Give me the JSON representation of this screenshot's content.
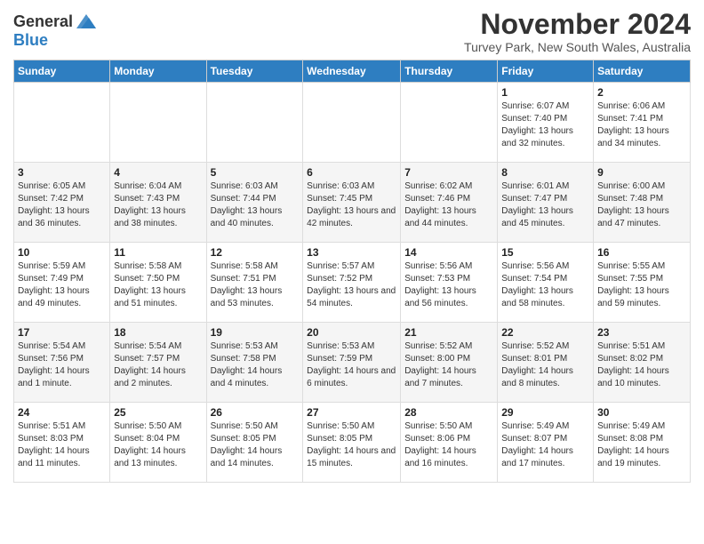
{
  "logo": {
    "general": "General",
    "blue": "Blue"
  },
  "title": "November 2024",
  "subtitle": "Turvey Park, New South Wales, Australia",
  "weekdays": [
    "Sunday",
    "Monday",
    "Tuesday",
    "Wednesday",
    "Thursday",
    "Friday",
    "Saturday"
  ],
  "weeks": [
    [
      {
        "date": "",
        "sunrise": "",
        "sunset": "",
        "daylight": ""
      },
      {
        "date": "",
        "sunrise": "",
        "sunset": "",
        "daylight": ""
      },
      {
        "date": "",
        "sunrise": "",
        "sunset": "",
        "daylight": ""
      },
      {
        "date": "",
        "sunrise": "",
        "sunset": "",
        "daylight": ""
      },
      {
        "date": "",
        "sunrise": "",
        "sunset": "",
        "daylight": ""
      },
      {
        "date": "1",
        "sunrise": "Sunrise: 6:07 AM",
        "sunset": "Sunset: 7:40 PM",
        "daylight": "Daylight: 13 hours and 32 minutes."
      },
      {
        "date": "2",
        "sunrise": "Sunrise: 6:06 AM",
        "sunset": "Sunset: 7:41 PM",
        "daylight": "Daylight: 13 hours and 34 minutes."
      }
    ],
    [
      {
        "date": "3",
        "sunrise": "Sunrise: 6:05 AM",
        "sunset": "Sunset: 7:42 PM",
        "daylight": "Daylight: 13 hours and 36 minutes."
      },
      {
        "date": "4",
        "sunrise": "Sunrise: 6:04 AM",
        "sunset": "Sunset: 7:43 PM",
        "daylight": "Daylight: 13 hours and 38 minutes."
      },
      {
        "date": "5",
        "sunrise": "Sunrise: 6:03 AM",
        "sunset": "Sunset: 7:44 PM",
        "daylight": "Daylight: 13 hours and 40 minutes."
      },
      {
        "date": "6",
        "sunrise": "Sunrise: 6:03 AM",
        "sunset": "Sunset: 7:45 PM",
        "daylight": "Daylight: 13 hours and 42 minutes."
      },
      {
        "date": "7",
        "sunrise": "Sunrise: 6:02 AM",
        "sunset": "Sunset: 7:46 PM",
        "daylight": "Daylight: 13 hours and 44 minutes."
      },
      {
        "date": "8",
        "sunrise": "Sunrise: 6:01 AM",
        "sunset": "Sunset: 7:47 PM",
        "daylight": "Daylight: 13 hours and 45 minutes."
      },
      {
        "date": "9",
        "sunrise": "Sunrise: 6:00 AM",
        "sunset": "Sunset: 7:48 PM",
        "daylight": "Daylight: 13 hours and 47 minutes."
      }
    ],
    [
      {
        "date": "10",
        "sunrise": "Sunrise: 5:59 AM",
        "sunset": "Sunset: 7:49 PM",
        "daylight": "Daylight: 13 hours and 49 minutes."
      },
      {
        "date": "11",
        "sunrise": "Sunrise: 5:58 AM",
        "sunset": "Sunset: 7:50 PM",
        "daylight": "Daylight: 13 hours and 51 minutes."
      },
      {
        "date": "12",
        "sunrise": "Sunrise: 5:58 AM",
        "sunset": "Sunset: 7:51 PM",
        "daylight": "Daylight: 13 hours and 53 minutes."
      },
      {
        "date": "13",
        "sunrise": "Sunrise: 5:57 AM",
        "sunset": "Sunset: 7:52 PM",
        "daylight": "Daylight: 13 hours and 54 minutes."
      },
      {
        "date": "14",
        "sunrise": "Sunrise: 5:56 AM",
        "sunset": "Sunset: 7:53 PM",
        "daylight": "Daylight: 13 hours and 56 minutes."
      },
      {
        "date": "15",
        "sunrise": "Sunrise: 5:56 AM",
        "sunset": "Sunset: 7:54 PM",
        "daylight": "Daylight: 13 hours and 58 minutes."
      },
      {
        "date": "16",
        "sunrise": "Sunrise: 5:55 AM",
        "sunset": "Sunset: 7:55 PM",
        "daylight": "Daylight: 13 hours and 59 minutes."
      }
    ],
    [
      {
        "date": "17",
        "sunrise": "Sunrise: 5:54 AM",
        "sunset": "Sunset: 7:56 PM",
        "daylight": "Daylight: 14 hours and 1 minute."
      },
      {
        "date": "18",
        "sunrise": "Sunrise: 5:54 AM",
        "sunset": "Sunset: 7:57 PM",
        "daylight": "Daylight: 14 hours and 2 minutes."
      },
      {
        "date": "19",
        "sunrise": "Sunrise: 5:53 AM",
        "sunset": "Sunset: 7:58 PM",
        "daylight": "Daylight: 14 hours and 4 minutes."
      },
      {
        "date": "20",
        "sunrise": "Sunrise: 5:53 AM",
        "sunset": "Sunset: 7:59 PM",
        "daylight": "Daylight: 14 hours and 6 minutes."
      },
      {
        "date": "21",
        "sunrise": "Sunrise: 5:52 AM",
        "sunset": "Sunset: 8:00 PM",
        "daylight": "Daylight: 14 hours and 7 minutes."
      },
      {
        "date": "22",
        "sunrise": "Sunrise: 5:52 AM",
        "sunset": "Sunset: 8:01 PM",
        "daylight": "Daylight: 14 hours and 8 minutes."
      },
      {
        "date": "23",
        "sunrise": "Sunrise: 5:51 AM",
        "sunset": "Sunset: 8:02 PM",
        "daylight": "Daylight: 14 hours and 10 minutes."
      }
    ],
    [
      {
        "date": "24",
        "sunrise": "Sunrise: 5:51 AM",
        "sunset": "Sunset: 8:03 PM",
        "daylight": "Daylight: 14 hours and 11 minutes."
      },
      {
        "date": "25",
        "sunrise": "Sunrise: 5:50 AM",
        "sunset": "Sunset: 8:04 PM",
        "daylight": "Daylight: 14 hours and 13 minutes."
      },
      {
        "date": "26",
        "sunrise": "Sunrise: 5:50 AM",
        "sunset": "Sunset: 8:05 PM",
        "daylight": "Daylight: 14 hours and 14 minutes."
      },
      {
        "date": "27",
        "sunrise": "Sunrise: 5:50 AM",
        "sunset": "Sunset: 8:05 PM",
        "daylight": "Daylight: 14 hours and 15 minutes."
      },
      {
        "date": "28",
        "sunrise": "Sunrise: 5:50 AM",
        "sunset": "Sunset: 8:06 PM",
        "daylight": "Daylight: 14 hours and 16 minutes."
      },
      {
        "date": "29",
        "sunrise": "Sunrise: 5:49 AM",
        "sunset": "Sunset: 8:07 PM",
        "daylight": "Daylight: 14 hours and 17 minutes."
      },
      {
        "date": "30",
        "sunrise": "Sunrise: 5:49 AM",
        "sunset": "Sunset: 8:08 PM",
        "daylight": "Daylight: 14 hours and 19 minutes."
      }
    ]
  ]
}
